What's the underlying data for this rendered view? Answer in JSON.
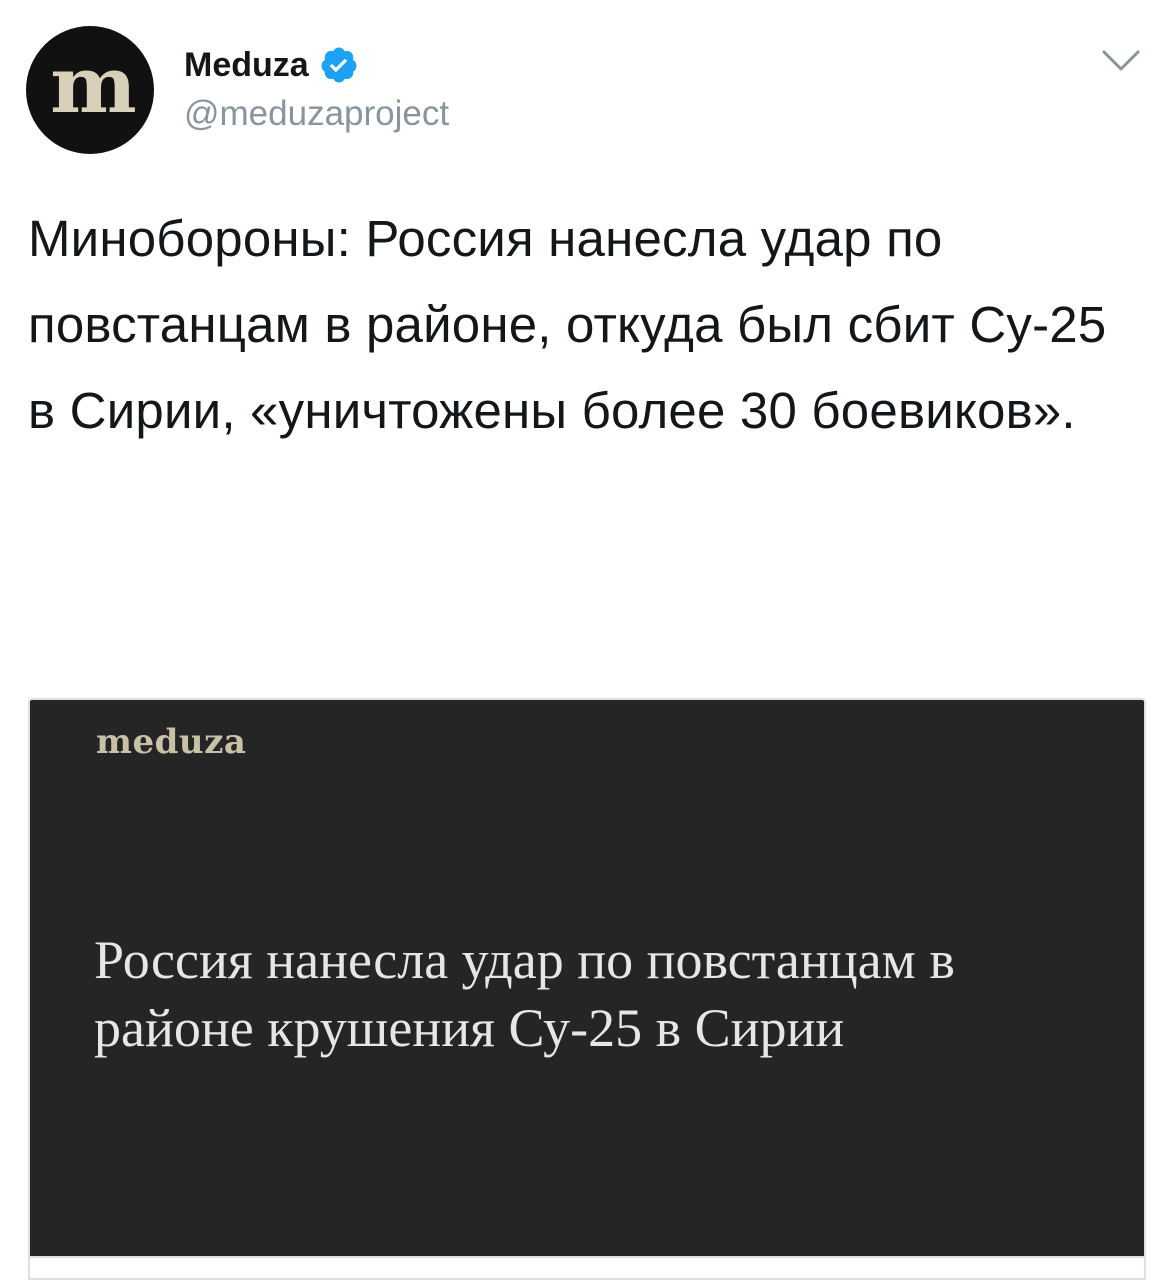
{
  "tweet": {
    "author": {
      "display_name": "Meduza",
      "handle": "@meduzaproject",
      "verified": true,
      "avatar_icon": "meduza-logo-icon",
      "avatar_mark": "m"
    },
    "menu_icon": "chevron-down-icon",
    "text": "Минобороны: Россия нанесла удар по повстанцам в районе, откуда был сбит Су-25 в Сирии, «уничтожены более 30 боевиков».",
    "card": {
      "logo_text": "meduza",
      "headline": "Россия нанесла удар по повстанцам в районе крушения Су-25 в Сирии"
    }
  },
  "colors": {
    "verified_badge": "#1da1f2",
    "handle_text": "#8a949e",
    "card_background": "#252525",
    "card_logo": "#c9c1a6",
    "card_headline": "#e6e6e6"
  }
}
